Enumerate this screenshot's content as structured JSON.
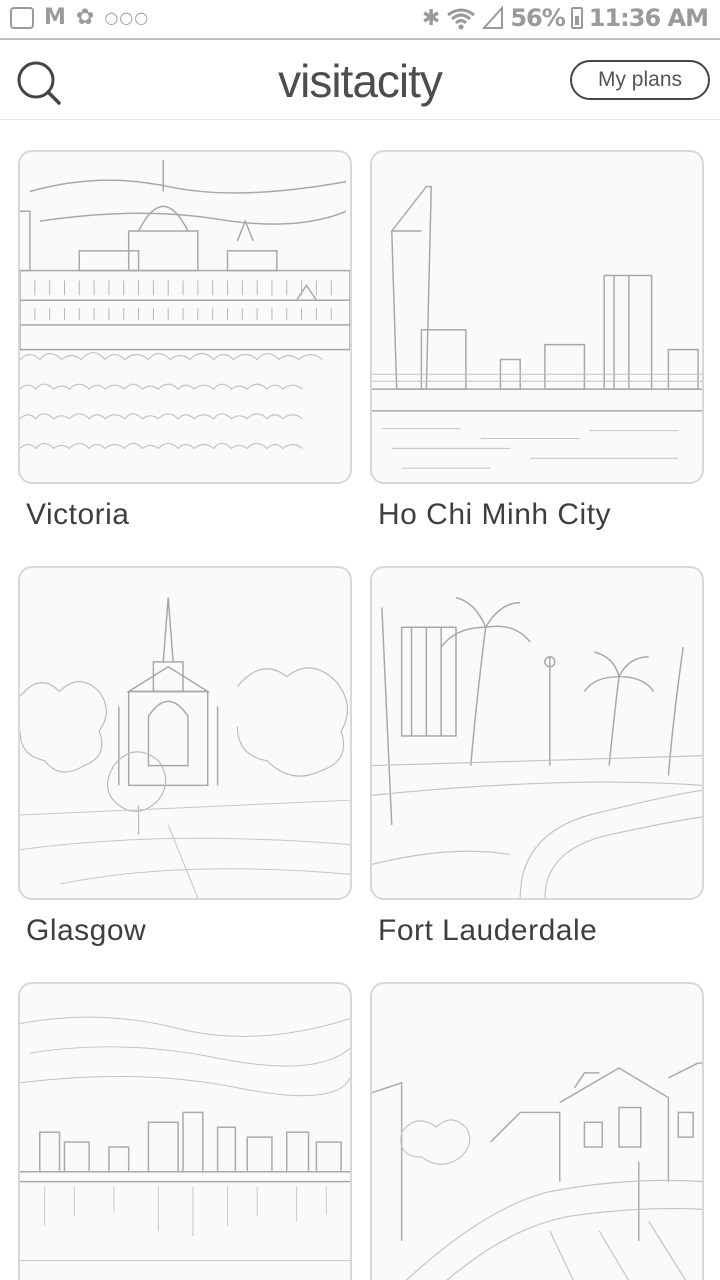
{
  "status_bar": {
    "left_icons": [
      "image-icon",
      "gmail-icon",
      "flower-icon",
      "more-dots-icon"
    ],
    "gmail_glyph": "M",
    "dots": "○○○",
    "battery": "56%",
    "time": "11:36 AM",
    "right_icons": [
      "bluetooth-icon",
      "wifi-icon",
      "signal-icon",
      "battery-icon"
    ]
  },
  "header": {
    "logo": "visitacity",
    "my_plans_label": "My plans"
  },
  "cities": [
    {
      "name": "Victoria",
      "scene": "parliament"
    },
    {
      "name": "Ho Chi Minh City",
      "scene": "skyline-river"
    },
    {
      "name": "Glasgow",
      "scene": "cathedral"
    },
    {
      "name": "Fort Lauderdale",
      "scene": "palms"
    },
    {
      "name": "",
      "scene": "skyline-lake"
    },
    {
      "name": "",
      "scene": "canal-houses"
    }
  ]
}
